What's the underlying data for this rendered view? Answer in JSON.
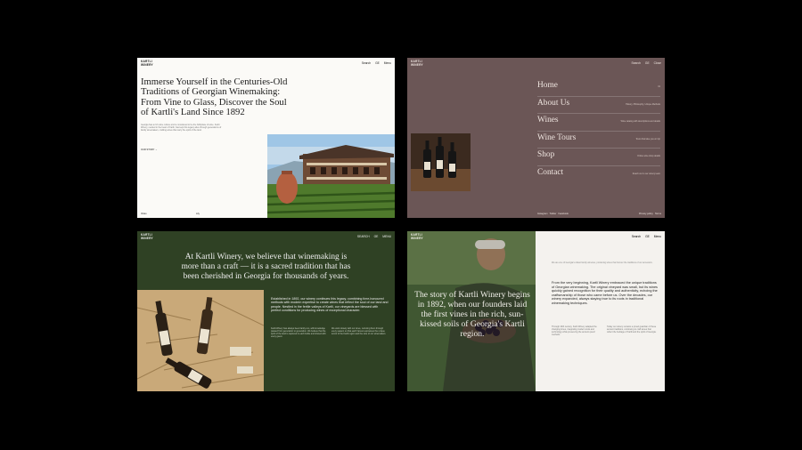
{
  "brand": {
    "logo_line1": "KARTLI",
    "logo_line2": "WINERY"
  },
  "card1": {
    "nav": [
      "Search",
      "GE",
      "Menu"
    ],
    "headline": "Immerse Yourself in the Centuries-Old Traditions of Georgian Winemaking: From Vine to Glass, Discover the Soul of Kartli's Land Since 1892",
    "intro": "Georgia has a rich wine culture and is considered to be the birthplace of wine. Kartli Winery, nestled in the heart of Kartli, has kept this legacy alive through generations of family winemakers, crafting wines that carry the spirit of the land.",
    "link": "OUR STORY",
    "footer_left": "Video",
    "footer_right": "Lily"
  },
  "card2": {
    "nav": [
      "Search",
      "GE",
      "Close"
    ],
    "menu": [
      {
        "label": "Home",
        "desc": "01"
      },
      {
        "label": "About Us",
        "desc": "History, Philosophy, Unique Methods"
      },
      {
        "label": "Wines",
        "desc": "Wine catalog with descriptions and details"
      },
      {
        "label": "Wine Tours",
        "desc": "Tours that take you on trip"
      },
      {
        "label": "Shop",
        "desc": "Online wine shop details"
      },
      {
        "label": "Contact",
        "desc": "Reach out to our winery team"
      }
    ],
    "footer_links": [
      "Instagram",
      "Twitter",
      "Facebook"
    ],
    "footer_right": [
      "Privacy policy",
      "Terms"
    ]
  },
  "card3": {
    "nav": [
      "SEARCH",
      "GE",
      "MENU"
    ],
    "headline": "At Kartli Winery, we believe that winemaking is more than a craft — it is a sacred tradition that has been cherished in Georgia for thousands of years.",
    "paragraph": "Established in 1892, our winery continues this legacy, combining time-honoured methods with modern expertise to create wines that reflect the soul of our land and people. Nestled in the fertile valleys of Kartli, our vineyards are blessed with perfect conditions for producing wines of exceptional character.",
    "small_left": "Kartli Winery has always been family-run, with knowledge passed from generation to generation. We believe that the spirit of the land is captured in each bottle and shared with every guest.",
    "small_right": "We work closely with our vines, nurturing them through every season so that each harvest expresses the unique terroir of the Kartli region and the care of our winemakers."
  },
  "card4": {
    "nav": [
      "Search",
      "GE",
      "Menu"
    ],
    "story": "The story of Kartli Winery begins in 1892, when our founders laid the first vines in the rich, sun-kissed soils of Georgia's Kartli region.",
    "intro": "We are one of Georgia's oldest family wineries, producing wines that honour the traditions of our ancestors.",
    "paragraph": "From the very beginning, Kartli Winery embraced the unique traditions of Georgian winemaking. The original vineyard was small, but its wines quickly gained recognition for their quality and authenticity, echoing the craftsmanship of those who came before us. Over the decades, our winery expanded, always staying true to its roots in traditional winemaking techniques.",
    "col1": "Through 20th century, Kartli Winery adapted the changing times, integrating modern tools and technology while preserving the ancient qvevri methods.",
    "col2": "Today our winery remains a proud guardian of these ancient traditions, continuing to craft wines that reflect the heritage of Kartli and the spirit of Georgia."
  }
}
